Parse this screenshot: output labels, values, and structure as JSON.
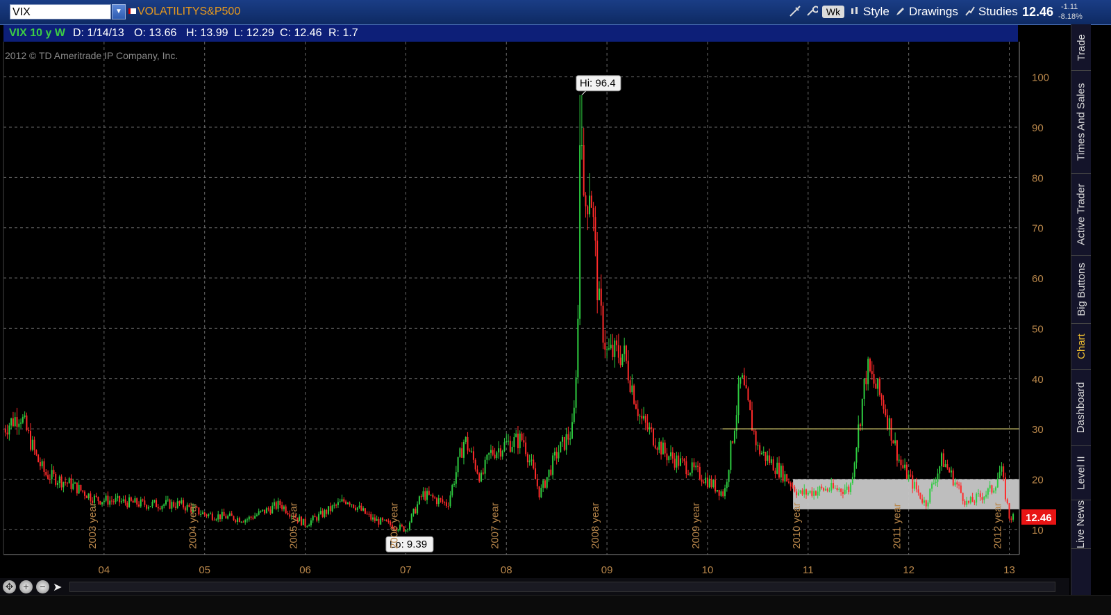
{
  "toolbar": {
    "symbol": "VIX",
    "description": "VOLATILITYS&P500",
    "wk_label": "Wk",
    "style_label": "Style",
    "drawings_label": "Drawings",
    "studies_label": "Studies",
    "last_price": "12.46",
    "net_change": "-1.11",
    "pct_change": "-8.18%"
  },
  "infobar": {
    "study_name": "VIX 10 y W",
    "date": "D: 1/14/13",
    "open": "O: 13.66",
    "high": "H: 13.99",
    "low": "L: 12.29",
    "close": "C: 12.46",
    "range": "R: 1.7"
  },
  "right_tabs": [
    "Trade",
    "Times And Sales",
    "Active Trader",
    "Big Buttons",
    "Chart",
    "Dashboard",
    "Level II",
    "Live News"
  ],
  "active_tab": "Chart",
  "colors": {
    "up": "#2ecc40",
    "down": "#ff2a2a",
    "axis_label": "#b8864a",
    "grid": "#6a6a6a",
    "resistance_line": "#d8d070",
    "zone": "#c8c8c8",
    "price_badge": "#e81414"
  },
  "chart_data": {
    "type": "candlestick",
    "title": "",
    "copyright": "2012 © TD Ameritrade IP Company, Inc.",
    "y_ticks": [
      10,
      20,
      30,
      40,
      50,
      60,
      70,
      80,
      90,
      100
    ],
    "ylim": [
      5,
      107
    ],
    "x_ticks": [
      "04",
      "05",
      "06",
      "07",
      "08",
      "09",
      "10",
      "11",
      "12",
      "13"
    ],
    "year_markers": [
      "2003 year",
      "2004 year",
      "2005 year",
      "2006 year",
      "2007 year",
      "2008 year",
      "2009 year",
      "2010 year",
      "2011 year",
      "2012 year"
    ],
    "high_label": "Hi: 96.4",
    "low_label": "Lo: 9.39",
    "last_label": "12.46",
    "resistance_level": 30,
    "support_zone": [
      14,
      20
    ],
    "approx_close_series": [
      {
        "date": "2003-01",
        "value": 30
      },
      {
        "date": "2003-03",
        "value": 33
      },
      {
        "date": "2003-05",
        "value": 24
      },
      {
        "date": "2003-06",
        "value": 21
      },
      {
        "date": "2003-09",
        "value": 19
      },
      {
        "date": "2003-12",
        "value": 16
      },
      {
        "date": "2004-06",
        "value": 15
      },
      {
        "date": "2004-10",
        "value": 15
      },
      {
        "date": "2005-01",
        "value": 13
      },
      {
        "date": "2005-06",
        "value": 12
      },
      {
        "date": "2005-10",
        "value": 15
      },
      {
        "date": "2006-01",
        "value": 11
      },
      {
        "date": "2006-06",
        "value": 16
      },
      {
        "date": "2006-09",
        "value": 12
      },
      {
        "date": "2007-01",
        "value": 10
      },
      {
        "date": "2007-03",
        "value": 17
      },
      {
        "date": "2007-06",
        "value": 15
      },
      {
        "date": "2007-08",
        "value": 28
      },
      {
        "date": "2007-10",
        "value": 20
      },
      {
        "date": "2007-11",
        "value": 25
      },
      {
        "date": "2008-01",
        "value": 27
      },
      {
        "date": "2008-03",
        "value": 28
      },
      {
        "date": "2008-05",
        "value": 17
      },
      {
        "date": "2008-07",
        "value": 25
      },
      {
        "date": "2008-09",
        "value": 30
      },
      {
        "date": "2008-10",
        "value": 70
      },
      {
        "date": "2008-11",
        "value": 80
      },
      {
        "date": "2008-12",
        "value": 55
      },
      {
        "date": "2009-01",
        "value": 45
      },
      {
        "date": "2009-03",
        "value": 45
      },
      {
        "date": "2009-05",
        "value": 32
      },
      {
        "date": "2009-08",
        "value": 25
      },
      {
        "date": "2009-12",
        "value": 21
      },
      {
        "date": "2010-03",
        "value": 17
      },
      {
        "date": "2010-05",
        "value": 40
      },
      {
        "date": "2010-07",
        "value": 26
      },
      {
        "date": "2010-10",
        "value": 21
      },
      {
        "date": "2010-12",
        "value": 17
      },
      {
        "date": "2011-03",
        "value": 18
      },
      {
        "date": "2011-06",
        "value": 18
      },
      {
        "date": "2011-08",
        "value": 42
      },
      {
        "date": "2011-10",
        "value": 35
      },
      {
        "date": "2011-12",
        "value": 23
      },
      {
        "date": "2012-03",
        "value": 15
      },
      {
        "date": "2012-05",
        "value": 24
      },
      {
        "date": "2012-08",
        "value": 15
      },
      {
        "date": "2012-11",
        "value": 18
      },
      {
        "date": "2012-12",
        "value": 22
      },
      {
        "date": "2013-01",
        "value": 12.46
      }
    ]
  }
}
